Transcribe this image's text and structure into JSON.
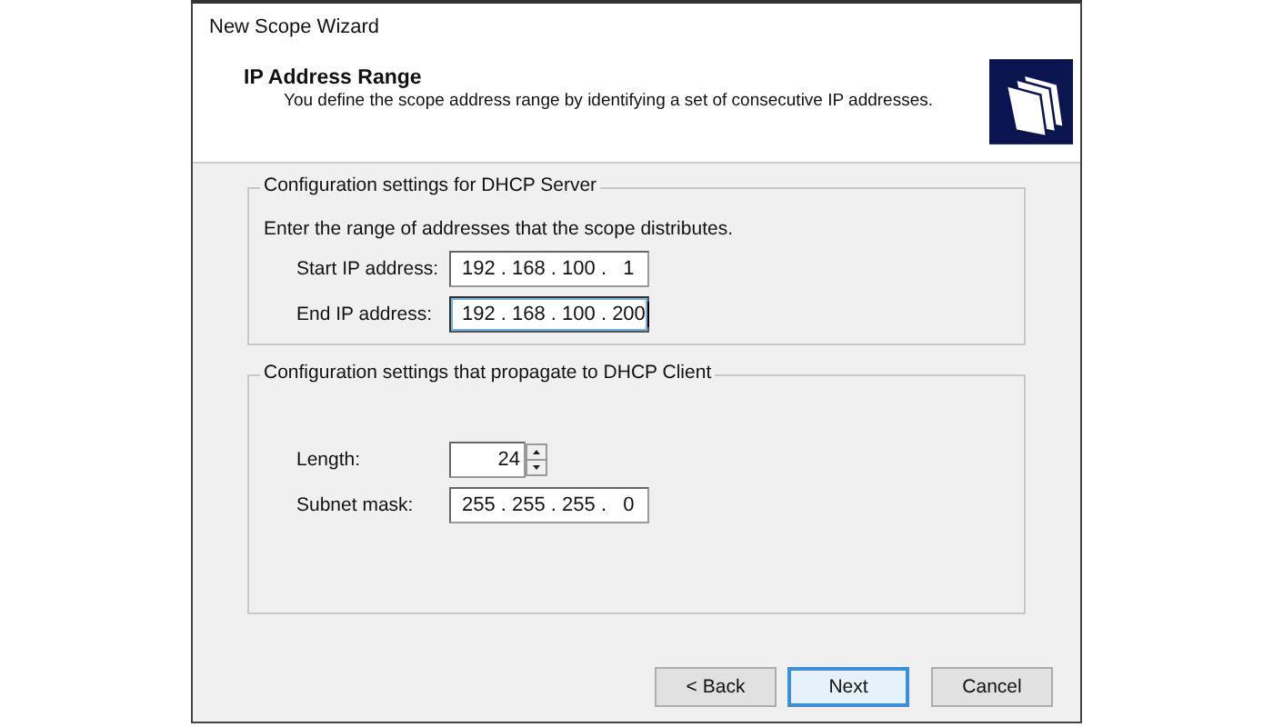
{
  "window": {
    "title": "New Scope Wizard"
  },
  "header": {
    "title": "IP Address Range",
    "subtitle": "You define the scope address range by identifying a set of consecutive IP addresses."
  },
  "groups": [
    {
      "legend": "Configuration settings for DHCP Server",
      "description": "Enter the range of addresses that the scope distributes.",
      "fields": [
        {
          "kind": "ip",
          "label": "Start IP address:",
          "value": "192 . 168 . 100 .   1",
          "focused": false
        },
        {
          "kind": "ip",
          "label": "End IP address:",
          "value": "192 . 168 . 100 . 200",
          "focused": true
        }
      ]
    },
    {
      "legend": "Configuration settings that propagate to DHCP Client",
      "fields": [
        {
          "kind": "spin",
          "label": "Length:",
          "value": "24",
          "focused": false
        },
        {
          "kind": "ip",
          "label": "Subnet mask:",
          "value": "255 . 255 . 255 .   0",
          "focused": false
        }
      ]
    }
  ],
  "buttons": [
    {
      "label": "< Back",
      "focused": false
    },
    {
      "label": "Next",
      "focused": true
    },
    {
      "label": "Cancel",
      "focused": false
    }
  ]
}
